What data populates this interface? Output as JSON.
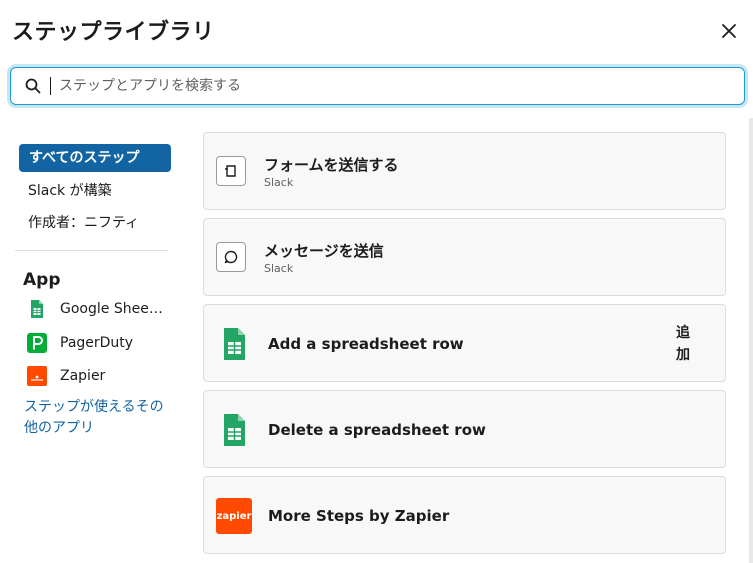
{
  "dialog": {
    "title": "ステップライブラリ"
  },
  "search": {
    "placeholder": "ステップとアプリを検索する",
    "value": ""
  },
  "sidebar": {
    "filters": [
      {
        "label": "すべてのステップ",
        "active": true
      },
      {
        "label": "Slack が構築",
        "active": false
      },
      {
        "label": "作成者：ニフティ",
        "active": false
      }
    ],
    "apps_heading": "App",
    "apps": [
      {
        "label": "Google Sheet…",
        "icon": "google-sheets-icon"
      },
      {
        "label": "PagerDuty",
        "icon": "pagerduty-icon"
      },
      {
        "label": "Zapier",
        "icon": "zapier-icon"
      }
    ],
    "more_apps_link": "ステップが使えるその他のアプリ"
  },
  "steps": [
    {
      "title": "フォームを送信する",
      "subtitle": "Slack",
      "icon": "form-icon"
    },
    {
      "title": "メッセージを送信",
      "subtitle": "Slack",
      "icon": "message-icon"
    },
    {
      "title": "Add a spreadsheet row",
      "icon": "google-sheets-icon",
      "action": "追加"
    },
    {
      "title": "Delete a spreadsheet row",
      "icon": "google-sheets-icon"
    },
    {
      "title": "More Steps by Zapier",
      "icon": "zapier-icon",
      "icon_text": "zapier"
    }
  ],
  "colors": {
    "accent": "#1264a3",
    "focus_ring": "#1d9bd1",
    "sheets_green": "#23a566",
    "pagerduty_green": "#06ac38",
    "zapier_orange": "#ff4a00"
  }
}
